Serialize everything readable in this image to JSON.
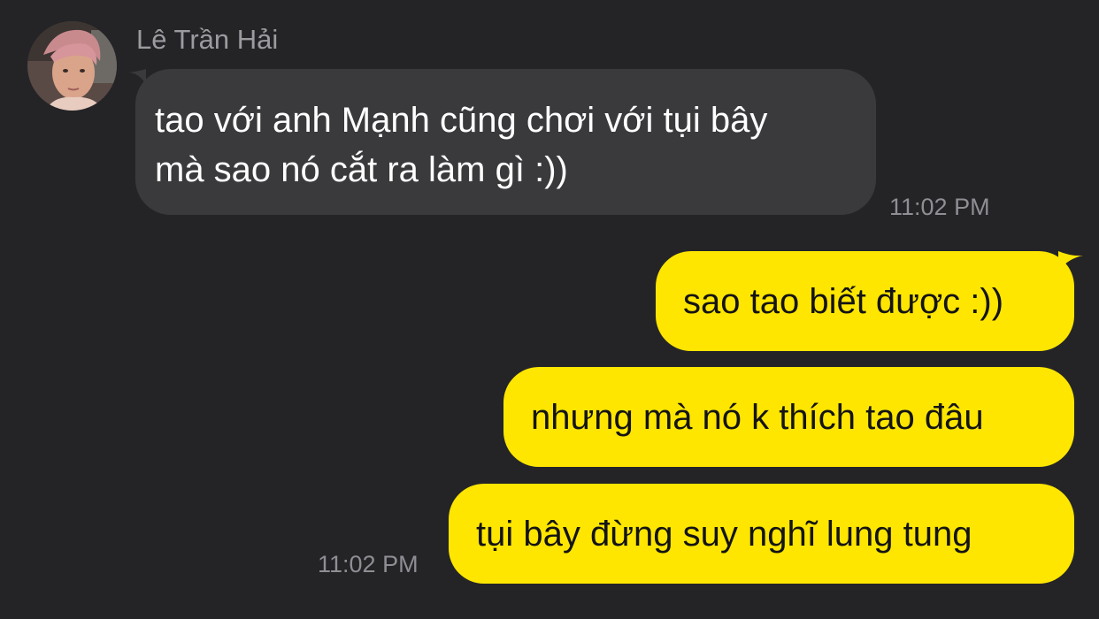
{
  "incoming": {
    "sender_name": "Lê Trần Hải",
    "message_lines": [
      "tao với anh Mạnh cũng chơi với tụi bây",
      "mà sao nó cắt ra làm gì :))"
    ],
    "timestamp": "11:02 PM",
    "avatar_icon": "user-photo-avatar"
  },
  "outgoing": {
    "messages": [
      "sao tao biết được :))",
      "nhưng mà nó k thích tao đâu",
      "tụi bây đừng suy nghĩ lung tung"
    ],
    "timestamp": "11:02 PM"
  },
  "colors": {
    "background": "#242427",
    "incoming_bubble": "#3a3a3d",
    "outgoing_bubble": "#ffe600",
    "timestamp_text": "#8e8e93"
  }
}
